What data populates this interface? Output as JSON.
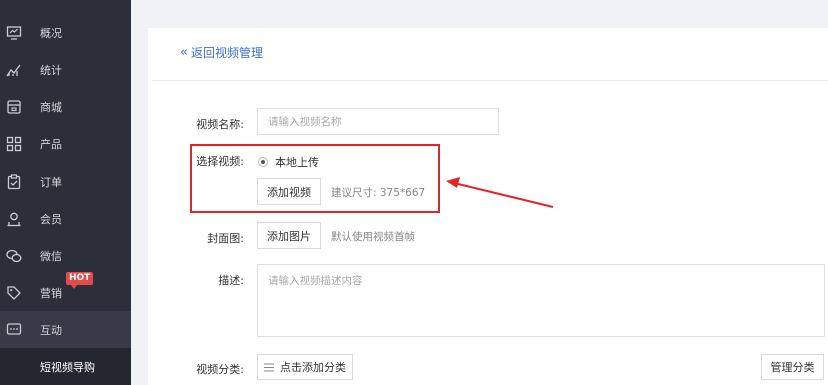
{
  "sidebar": {
    "items": [
      {
        "label": "概况",
        "icon": "monitor-icon"
      },
      {
        "label": "统计",
        "icon": "chart-icon"
      },
      {
        "label": "商城",
        "icon": "store-icon"
      },
      {
        "label": "产品",
        "icon": "grid-icon"
      },
      {
        "label": "订单",
        "icon": "clipboard-icon"
      },
      {
        "label": "会员",
        "icon": "members-icon"
      },
      {
        "label": "微信",
        "icon": "wechat-icon"
      },
      {
        "label": "营销",
        "icon": "tag-icon"
      },
      {
        "label": "互动",
        "icon": "chat-icon"
      }
    ],
    "hot_badge": "HOT",
    "sub_item": "短视频导购"
  },
  "page": {
    "back_label": "返回视频管理"
  },
  "form": {
    "name_label": "视频名称:",
    "name_placeholder": "请输入视频名称",
    "select_video_label": "选择视频:",
    "local_upload_option": "本地上传",
    "add_video_button": "添加视频",
    "size_hint": "建议尺寸: 375*667",
    "cover_label": "封面图:",
    "add_image_button": "添加图片",
    "cover_hint": "默认使用视频首帧",
    "desc_label": "描述:",
    "desc_placeholder": "请输入视频描述内容",
    "category_label": "视频分类:",
    "add_category_button": "点击添加分类",
    "manage_category_button": "管理分类"
  },
  "colors": {
    "sidebar_bg": "#2b2f3a",
    "link": "#3b6fc7",
    "highlight": "#e0262b"
  }
}
